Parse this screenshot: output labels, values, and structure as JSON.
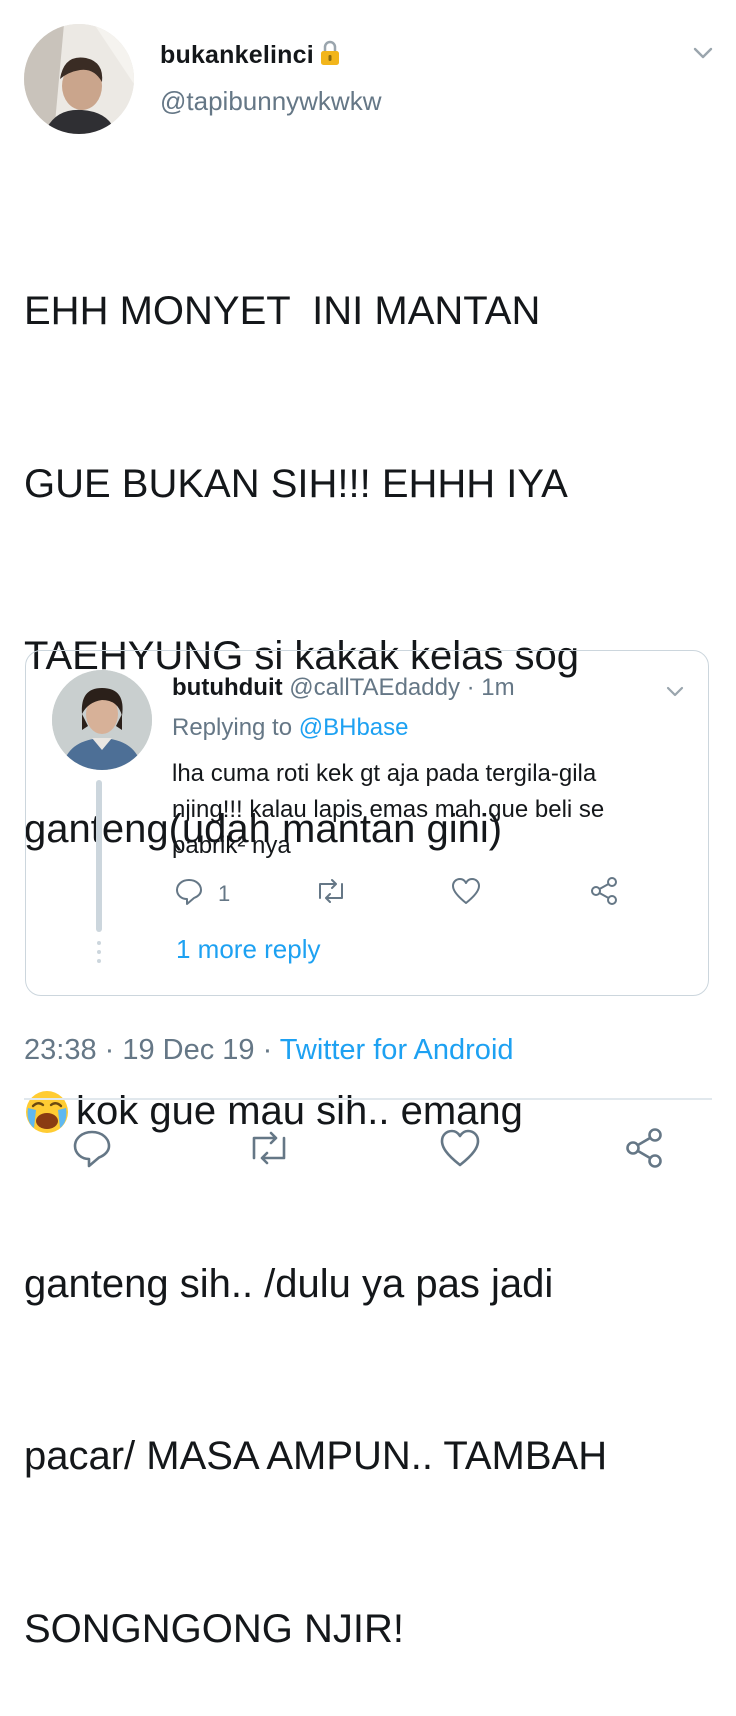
{
  "tweet": {
    "display_name": "bukankelinci",
    "handle": "@tapibunnywkwkw",
    "text_lines": [
      "EHH MONYET  INI MANTAN",
      "GUE BUKAN SIH!!! EHHH IYA",
      "TAEHYUNG si kakak kelas sog",
      "ganteng(udah mantan gini)",
      "kok gue mau sih.. emang",
      "ganteng sih.. /dulu ya pas jadi",
      "pacar/ MASA AMPUN.. TAMBAH",
      "SONGNGONG NJIR!"
    ],
    "emoji_icon": "loudly-crying-face-icon",
    "timestamp": "23:38 · 19 Dec 19 · ",
    "source": "Twitter for Android"
  },
  "quote": {
    "display_name": "butuhduit",
    "handle_meta": " @callTAEdaddy · 1m",
    "replying_prefix": "Replying to ",
    "replying_to": "@BHbase",
    "text": "lha cuma roti kek gt aja pada tergila-gila\nnjing!!! kalau lapis emas mah gue beli se\npabrik² nya",
    "reply_count": "1",
    "more_reply": "1 more reply"
  },
  "colors": {
    "accent": "#1da1f2",
    "text": "#14171a",
    "muted": "#657786",
    "border": "#ccd6dd"
  }
}
